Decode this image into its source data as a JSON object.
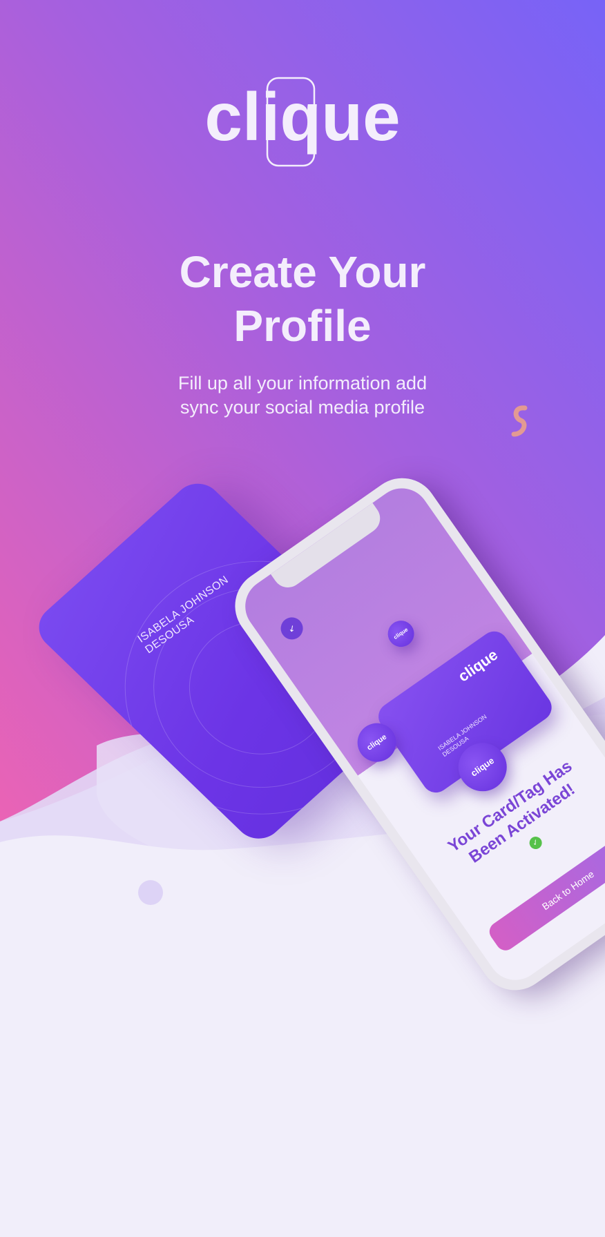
{
  "brand": {
    "logo_text": "clique"
  },
  "hero": {
    "title_line1": "Create Your",
    "title_line2": "Profile",
    "subtitle_line1": "Fill up all your information add",
    "subtitle_line2": "sync your social media profile"
  },
  "card": {
    "name_line1": "ISABELA JOHNSON",
    "name_line2": "DESOUSA"
  },
  "phone_screen": {
    "card_logo": "clique",
    "card_name_line1": "ISABELA JOHNSON",
    "card_name_line2": "DESOUSA",
    "tag_small_label": "clique",
    "tag_left_label": "clique",
    "tag_big_label": "clique",
    "message_line1": "Your Card/Tag Has",
    "message_line2": "Been Activated!",
    "button_label": "Back to Home"
  },
  "colors": {
    "gradient_top_right": "#7b63f5",
    "gradient_mid": "#a55fde",
    "gradient_bottom_left": "#e564b7",
    "card_purple": "#6c34e6",
    "page_bg": "#f1eefa",
    "success_green": "#56c14a"
  }
}
